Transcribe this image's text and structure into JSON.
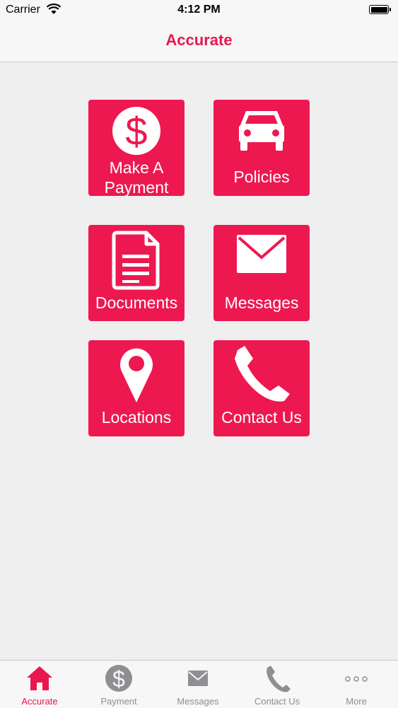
{
  "status_bar": {
    "carrier": "Carrier",
    "time": "4:12 PM"
  },
  "nav": {
    "title": "Accurate"
  },
  "tiles": [
    {
      "label": "Make A Payment",
      "icon": "dollar-circle-icon"
    },
    {
      "label": "Policies",
      "icon": "car-icon"
    },
    {
      "label": "Documents",
      "icon": "document-icon"
    },
    {
      "label": "Messages",
      "icon": "envelope-icon"
    },
    {
      "label": "Locations",
      "icon": "map-pin-icon"
    },
    {
      "label": "Contact Us",
      "icon": "phone-icon"
    }
  ],
  "tabs": [
    {
      "label": "Accurate",
      "icon": "home-icon",
      "active": true
    },
    {
      "label": "Payment",
      "icon": "dollar-circle-icon",
      "active": false
    },
    {
      "label": "Messages",
      "icon": "envelope-icon",
      "active": false
    },
    {
      "label": "Contact Us",
      "icon": "phone-icon",
      "active": false
    },
    {
      "label": "More",
      "icon": "more-dots-icon",
      "active": false
    }
  ],
  "colors": {
    "accent": "#e8174f",
    "tile": "#ee1850",
    "background": "#f0eff0",
    "bar": "#f7f7f7",
    "inactive_tab": "#8e8e93"
  }
}
